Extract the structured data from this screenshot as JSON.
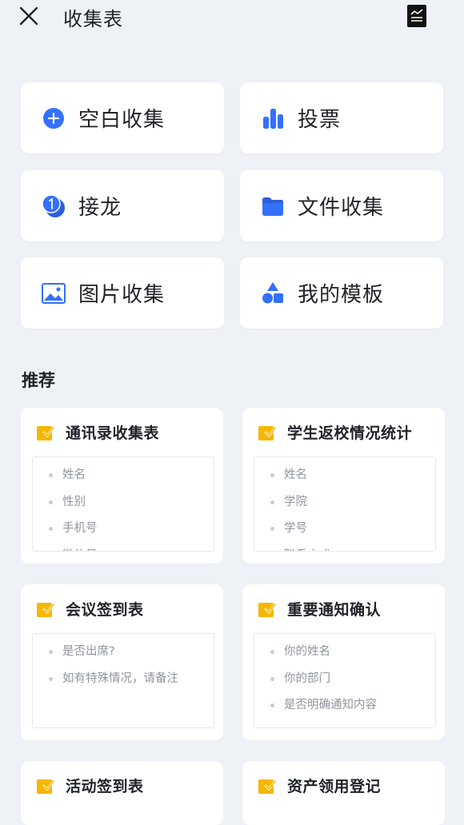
{
  "header": {
    "title": "收集表",
    "close_icon": "close-icon",
    "stats_icon": "chart-icon"
  },
  "tiles": [
    {
      "label": "空白收集",
      "icon": "plus-circle-icon"
    },
    {
      "label": "投票",
      "icon": "bar-chart-icon"
    },
    {
      "label": "接龙",
      "icon": "relay-icon"
    },
    {
      "label": "文件收集",
      "icon": "folder-icon"
    },
    {
      "label": "图片收集",
      "icon": "image-icon"
    },
    {
      "label": "我的模板",
      "icon": "shapes-icon"
    }
  ],
  "recommend": {
    "title": "推荐",
    "cards": [
      {
        "title": "通讯录收集表",
        "fields": [
          "姓名",
          "性别",
          "手机号",
          "微信号"
        ]
      },
      {
        "title": "学生返校情况统计",
        "fields": [
          "姓名",
          "学院",
          "学号",
          "联系方式"
        ]
      },
      {
        "title": "会议签到表",
        "fields": [
          "是否出席?",
          "如有特殊情况，请备注"
        ]
      },
      {
        "title": "重要通知确认",
        "fields": [
          "你的姓名",
          "你的部门",
          "是否明确通知内容"
        ]
      },
      {
        "title": "活动签到表",
        "fields": []
      },
      {
        "title": "资产领用登记",
        "fields": []
      }
    ]
  },
  "colors": {
    "accent_blue": "#3370ff",
    "check_yellow": "#f5b700",
    "background": "#eef1f6"
  }
}
